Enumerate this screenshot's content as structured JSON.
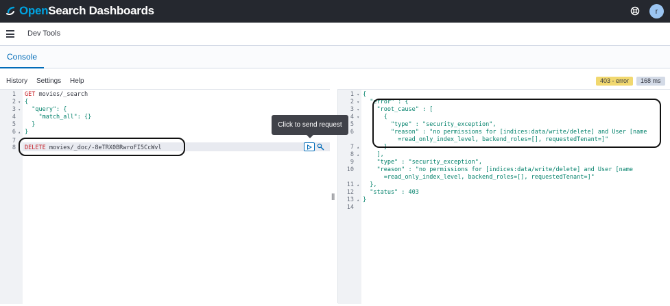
{
  "app": {
    "brand_first": "Open",
    "brand_second": "Search Dashboards",
    "avatar_letter": "r",
    "help_icon": "help-icon"
  },
  "header": {
    "breadcrumb": "Dev Tools",
    "menu_icon": "hamburger-icon"
  },
  "tabs": [
    {
      "label": "Console",
      "active": true
    }
  ],
  "toolbar": {
    "items": [
      "History",
      "Settings",
      "Help"
    ],
    "status_badge": "403 - error",
    "time_badge": "168 ms"
  },
  "tooltip": "Click to send request",
  "request_lines": [
    {
      "n": "1",
      "fold": "",
      "method": "GET",
      "rest": " movies/_search"
    },
    {
      "n": "2",
      "fold": "▾",
      "method": "",
      "rest": "{"
    },
    {
      "n": "3",
      "fold": "▾",
      "method": "",
      "rest": "  \"query\": {"
    },
    {
      "n": "4",
      "fold": "",
      "method": "",
      "rest": "    \"match_all\": {}"
    },
    {
      "n": "5",
      "fold": "",
      "method": "",
      "rest": "  }"
    },
    {
      "n": "6",
      "fold": "▴",
      "method": "",
      "rest": "}"
    },
    {
      "n": "7",
      "fold": "",
      "method": "",
      "rest": ""
    },
    {
      "n": "8",
      "fold": "",
      "method": "DELETE",
      "rest": " movies/_doc/-8eTRX0BRwroFI5CcWvl"
    }
  ],
  "response_lines": [
    {
      "n": "1",
      "fold": "▾",
      "text": "{"
    },
    {
      "n": "2",
      "fold": "▾",
      "text": "  \"error\" : {"
    },
    {
      "n": "3",
      "fold": "▾",
      "text": "    \"root_cause\" : ["
    },
    {
      "n": "4",
      "fold": "▾",
      "text": "      {"
    },
    {
      "n": "5",
      "fold": "",
      "text": "        \"type\" : \"security_exception\","
    },
    {
      "n": "6",
      "fold": "",
      "text": "        \"reason\" : \"no permissions for [indices:data/write/delete] and User [name"
    },
    {
      "n": "",
      "fold": "",
      "text": "          =read_only_index_level, backend_roles=[], requestedTenant=]\""
    },
    {
      "n": "7",
      "fold": "▴",
      "text": "      }"
    },
    {
      "n": "8",
      "fold": "▴",
      "text": "    ],"
    },
    {
      "n": "9",
      "fold": "",
      "text": "    \"type\" : \"security_exception\","
    },
    {
      "n": "10",
      "fold": "",
      "text": "    \"reason\" : \"no permissions for [indices:data/write/delete] and User [name"
    },
    {
      "n": "",
      "fold": "",
      "text": "      =read_only_index_level, backend_roles=[], requestedTenant=]\""
    },
    {
      "n": "11",
      "fold": "▴",
      "text": "  },"
    },
    {
      "n": "12",
      "fold": "",
      "text": "  \"status\" : 403"
    },
    {
      "n": "13",
      "fold": "▴",
      "text": "}"
    },
    {
      "n": "14",
      "fold": "",
      "text": ""
    }
  ],
  "colors": {
    "topbar": "#25282f",
    "accent": "#006bb8",
    "error_badge": "#f1d86f",
    "method": "#c61e25",
    "json_string": "#00806a"
  }
}
